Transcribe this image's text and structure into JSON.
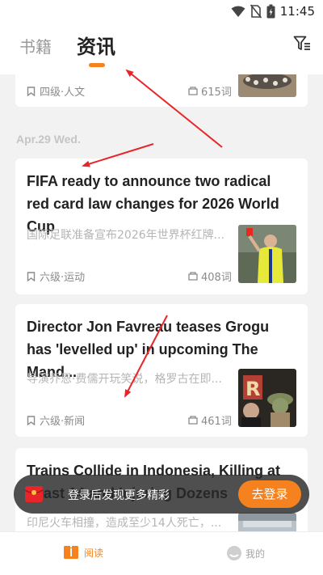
{
  "status_bar": {
    "time": "11:45"
  },
  "header": {
    "tabs": [
      {
        "label": "书籍"
      },
      {
        "label": "资讯"
      }
    ]
  },
  "feed": {
    "top_card": {
      "meta": "四级·人文",
      "words": "615词"
    },
    "date_label": "Apr.29 Wed.",
    "articles": [
      {
        "title": "FIFA ready to announce two radical red card law changes for 2026 World Cup",
        "summary": "国际足联准备宣布2026年世界杯红牌...",
        "meta": "六级·运动",
        "words": "408词"
      },
      {
        "title": "Director Jon Favreau teases Grogu has 'levelled up' in upcoming The Mand...",
        "summary": "导演乔恩·费儒开玩笑说，格罗古在即...",
        "meta": "六级·新闻",
        "words": "461词"
      },
      {
        "title": "Trains Collide in Indonesia, Killing at Least 14 and Injuring Dozens",
        "summary": "印尼火车相撞，造成至少14人死亡，..."
      }
    ]
  },
  "toast": {
    "text": "登录后发现更多精彩",
    "button": "去登录"
  },
  "bottom_nav": {
    "items": [
      {
        "label": "阅读",
        "active": true
      },
      {
        "label": "我的",
        "active": false
      }
    ]
  },
  "colors": {
    "accent": "#f5821f",
    "annotation_arrow": "#e8262a"
  }
}
